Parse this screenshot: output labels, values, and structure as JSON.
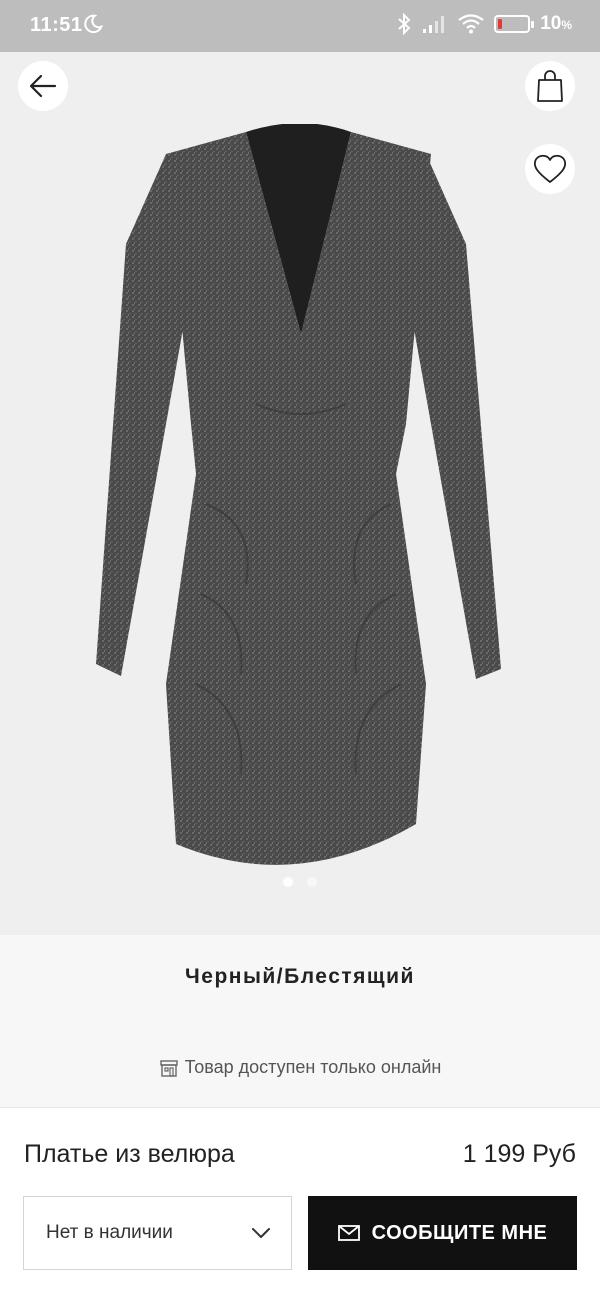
{
  "status_bar": {
    "time": "11:51",
    "battery_level": "10",
    "battery_unit": "%"
  },
  "product": {
    "color_name": "Черный/Блестящий",
    "availability_note": "Товар доступен только онлайн",
    "name": "Платье из велюра",
    "price": "1 199 Руб"
  },
  "actions": {
    "size_select_value": "Нет в наличии",
    "notify_label": "СООБЩИТЕ МНЕ"
  },
  "gallery": {
    "total_images": 2,
    "active_index": 0
  },
  "icons": {
    "back": "arrow-left-icon",
    "bag": "shopping-bag-icon",
    "favorite": "heart-icon",
    "store": "store-icon",
    "chevron": "chevron-down-icon",
    "mail": "mail-icon"
  },
  "colors": {
    "status_bar_bg": "#bdbdbd",
    "hero_bg": "#efefef",
    "button_dark": "#111111",
    "battery_low": "#e53935"
  }
}
